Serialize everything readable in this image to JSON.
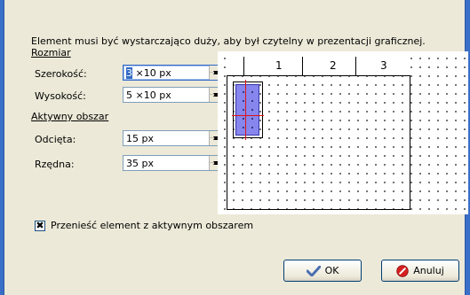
{
  "dialog": {
    "intro": "Element musi być wystarczająco duży, aby był czytelny w prezentacji graficznej."
  },
  "size_section": {
    "title": "Rozmiar",
    "width": {
      "label": "Szerokość:",
      "value_selected": "3",
      "value_rest": " ×10 px"
    },
    "height": {
      "label": "Wysokość:",
      "value": "5 ×10 px"
    }
  },
  "active_section": {
    "title": "Aktywny obszar",
    "x": {
      "label": "Odcięta:",
      "value": "15 px"
    },
    "y": {
      "label": "Rzędna:",
      "value": "35 px"
    }
  },
  "preview": {
    "columns": [
      "1",
      "2",
      "3"
    ]
  },
  "options": {
    "move_with_active": {
      "label": "Przenieść element z aktywnym obszarem",
      "checked": true,
      "mark": "✖"
    }
  },
  "buttons": {
    "ok": "OK",
    "cancel": "Anuluj"
  },
  "icons": {
    "ok": "check-icon",
    "cancel": "cancel-icon"
  },
  "colors": {
    "accent": "#316ac5",
    "element_fill": "#8686ee",
    "crosshair": "#e21414"
  }
}
